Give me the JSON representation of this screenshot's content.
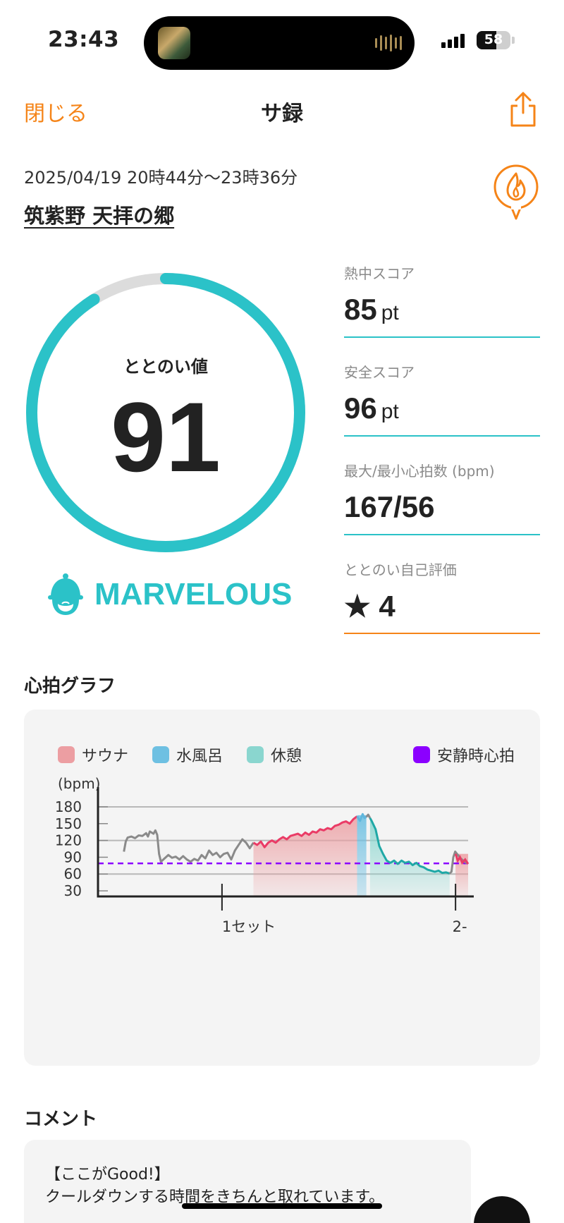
{
  "status_bar": {
    "time": "23:43",
    "battery": "58",
    "battery_level": 0.58
  },
  "nav": {
    "close_label": "閉じる",
    "title": "サ録"
  },
  "session": {
    "datetime": "2025/04/19 20時44分〜23時36分",
    "facility": "筑紫野 天拝の郷"
  },
  "score": {
    "label": "ととのい値",
    "value": "91",
    "ring_fraction": 0.91,
    "rank": "MARVELOUS"
  },
  "stats": [
    {
      "label": "熱中スコア",
      "value": "85",
      "unit": "pt"
    },
    {
      "label": "安全スコア",
      "value": "96",
      "unit": "pt"
    },
    {
      "label": "最大/最小心拍数 (bpm)",
      "value": "167/56",
      "unit": ""
    },
    {
      "label": "ととのい自己評価",
      "value": "★ 4",
      "unit": ""
    }
  ],
  "colors": {
    "accent_orange": "#f58418",
    "accent_teal": "#2bc2c8",
    "sauna": "#ea3b66",
    "cold_bath": "#5fb6dc",
    "rest": "#1fa8a6",
    "resting_hr": "#8b00ff"
  },
  "graph": {
    "title": "心拍グラフ",
    "legend": [
      {
        "label": "サウナ",
        "color": "#ec9ea2"
      },
      {
        "label": "水風呂",
        "color": "#6ec0e2"
      },
      {
        "label": "休憩",
        "color": "#8ad6cf"
      },
      {
        "label": "安静時心拍",
        "color": "#8b00ff"
      }
    ],
    "y_unit": "(bpm)",
    "y_ticks": [
      "180",
      "150",
      "120",
      "90",
      "60",
      "30"
    ],
    "x_ticks": [
      "1セット",
      "2-"
    ]
  },
  "chart_data": {
    "type": "line",
    "title": "心拍グラフ",
    "ylabel": "(bpm)",
    "xlabel": "",
    "ylim": [
      20,
      190
    ],
    "y_ticks": [
      30,
      60,
      90,
      120,
      150,
      180
    ],
    "x_ticks": [
      "1セット",
      "2-"
    ],
    "resting_hr": 79,
    "xlim": [
      0,
      100
    ],
    "series": [
      {
        "segment": "other",
        "points": [
          [
            7,
            100
          ],
          [
            7.5,
            118
          ],
          [
            8,
            125
          ],
          [
            9,
            127
          ],
          [
            10,
            124
          ],
          [
            11,
            129
          ],
          [
            12,
            128
          ],
          [
            13,
            133
          ],
          [
            13.5,
            127
          ],
          [
            14,
            136
          ],
          [
            15,
            132
          ],
          [
            15.5,
            138
          ],
          [
            16,
            130
          ],
          [
            16.5,
            96
          ],
          [
            17,
            82
          ],
          [
            18,
            88
          ],
          [
            19,
            94
          ],
          [
            20,
            89
          ],
          [
            21,
            91
          ],
          [
            22,
            86
          ],
          [
            23,
            92
          ],
          [
            24,
            86
          ],
          [
            25,
            82
          ],
          [
            26,
            87
          ],
          [
            27,
            84
          ],
          [
            28,
            94
          ],
          [
            29,
            88
          ],
          [
            30,
            102
          ],
          [
            31,
            94
          ],
          [
            32,
            98
          ],
          [
            33,
            90
          ],
          [
            34,
            96
          ],
          [
            35,
            98
          ],
          [
            36,
            86
          ],
          [
            37,
            102
          ],
          [
            38,
            112
          ],
          [
            39,
            122
          ],
          [
            40,
            116
          ],
          [
            41,
            106
          ],
          [
            42,
            116
          ]
        ]
      },
      {
        "segment": "sauna",
        "points": [
          [
            42,
            116
          ],
          [
            43,
            112
          ],
          [
            44,
            118
          ],
          [
            45,
            108
          ],
          [
            46,
            116
          ],
          [
            47,
            120
          ],
          [
            48,
            116
          ],
          [
            49,
            122
          ],
          [
            50,
            126
          ],
          [
            51,
            122
          ],
          [
            52,
            128
          ],
          [
            53,
            130
          ],
          [
            54,
            132
          ],
          [
            55,
            128
          ],
          [
            56,
            134
          ],
          [
            57,
            130
          ],
          [
            58,
            136
          ],
          [
            59,
            134
          ],
          [
            60,
            140
          ],
          [
            61,
            138
          ],
          [
            62,
            142
          ],
          [
            63,
            140
          ],
          [
            64,
            146
          ],
          [
            65,
            148
          ],
          [
            66,
            152
          ],
          [
            67,
            154
          ],
          [
            68,
            150
          ],
          [
            69,
            158
          ],
          [
            70,
            163
          ]
        ]
      },
      {
        "segment": "cold_bath",
        "points": [
          [
            70,
            163
          ],
          [
            70.8,
            155
          ],
          [
            71.5,
            167
          ],
          [
            72,
            160
          ],
          [
            72.5,
            162
          ]
        ]
      },
      {
        "segment": "other",
        "points": [
          [
            72.5,
            162
          ],
          [
            73,
            166
          ],
          [
            73.5,
            160
          ]
        ]
      },
      {
        "segment": "rest",
        "points": [
          [
            73.5,
            160
          ],
          [
            74,
            154
          ],
          [
            75,
            140
          ],
          [
            76,
            110
          ],
          [
            77,
            96
          ],
          [
            78,
            84
          ],
          [
            79,
            80
          ],
          [
            80,
            84
          ],
          [
            81,
            78
          ],
          [
            82,
            84
          ],
          [
            83,
            80
          ],
          [
            84,
            82
          ],
          [
            85,
            76
          ],
          [
            86,
            80
          ],
          [
            87,
            74
          ],
          [
            88,
            72
          ],
          [
            89,
            68
          ],
          [
            90,
            66
          ],
          [
            91,
            64
          ],
          [
            92,
            66
          ],
          [
            93,
            62
          ],
          [
            94,
            63
          ],
          [
            95,
            61
          ]
        ]
      },
      {
        "segment": "other",
        "points": [
          [
            95,
            61
          ],
          [
            95.5,
            64
          ],
          [
            96,
            90
          ],
          [
            96.5,
            100
          ],
          [
            97,
            96
          ],
          [
            97.5,
            92
          ],
          [
            98,
            88
          ],
          [
            98.5,
            85
          ],
          [
            99,
            82
          ],
          [
            99.5,
            80
          ],
          [
            100,
            79
          ]
        ]
      }
    ]
  },
  "comment": {
    "title": "コメント",
    "line1": "【ここがGood!】",
    "line2": "クールダウンする時間をきちんと取れています。"
  }
}
